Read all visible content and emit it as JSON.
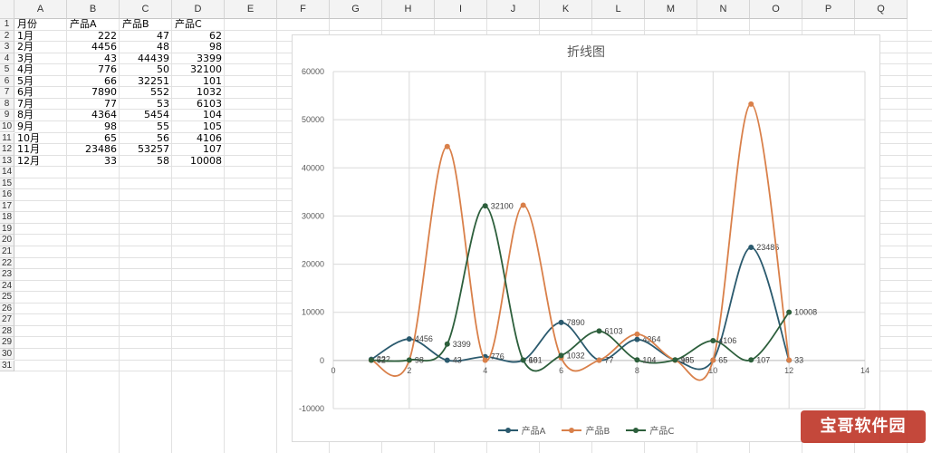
{
  "columns": [
    "A",
    "B",
    "C",
    "D",
    "E",
    "F",
    "G",
    "H",
    "I",
    "J",
    "K",
    "L",
    "M",
    "N",
    "O",
    "P",
    "Q"
  ],
  "row_numbers": [
    "1",
    "2",
    "3",
    "4",
    "5",
    "6",
    "7",
    "8",
    "9",
    "10",
    "11",
    "12",
    "13",
    "14",
    "15",
    "16",
    "17",
    "18",
    "19",
    "20",
    "21",
    "22",
    "23",
    "24",
    "25",
    "26",
    "27",
    "28",
    "29",
    "30",
    "31"
  ],
  "table": {
    "header": [
      "月份",
      "产品A",
      "产品B",
      "产品C"
    ],
    "rows": [
      [
        "1月",
        "222",
        "47",
        "62"
      ],
      [
        "2月",
        "4456",
        "48",
        "98"
      ],
      [
        "3月",
        "43",
        "44439",
        "3399"
      ],
      [
        "4月",
        "776",
        "50",
        "32100"
      ],
      [
        "5月",
        "66",
        "32251",
        "101"
      ],
      [
        "6月",
        "7890",
        "552",
        "1032"
      ],
      [
        "7月",
        "77",
        "53",
        "6103"
      ],
      [
        "8月",
        "4364",
        "5454",
        "104"
      ],
      [
        "9月",
        "98",
        "55",
        "105"
      ],
      [
        "10月",
        "65",
        "56",
        "4106"
      ],
      [
        "11月",
        "23486",
        "53257",
        "107"
      ],
      [
        "12月",
        "33",
        "58",
        "10008"
      ]
    ]
  },
  "chart_data": {
    "type": "scatter",
    "title": "折线图",
    "xlim": [
      0,
      14
    ],
    "ylim": [
      -10000,
      60000
    ],
    "x_ticks": [
      0,
      2,
      4,
      6,
      8,
      10,
      12,
      14
    ],
    "y_ticks": [
      -10000,
      0,
      10000,
      20000,
      30000,
      40000,
      50000,
      60000
    ],
    "grid": true,
    "smooth": true,
    "legend_position": "bottom",
    "series": [
      {
        "name": "产品A",
        "color": "#2b5a6e",
        "x": [
          1,
          2,
          3,
          4,
          5,
          6,
          7,
          8,
          9,
          10,
          11,
          12
        ],
        "values": [
          222,
          4456,
          43,
          776,
          66,
          7890,
          77,
          4364,
          98,
          65,
          23486,
          33
        ],
        "labels": [
          "222",
          "4456",
          "43",
          "776",
          "66",
          "7890",
          "77",
          "4364",
          "98",
          "65",
          "23486",
          "33"
        ]
      },
      {
        "name": "产品B",
        "color": "#d9804a",
        "x": [
          1,
          2,
          3,
          4,
          5,
          6,
          7,
          8,
          9,
          10,
          11,
          12
        ],
        "values": [
          47,
          48,
          44439,
          50,
          32251,
          552,
          53,
          5454,
          55,
          56,
          53257,
          58
        ],
        "labels": []
      },
      {
        "name": "产品C",
        "color": "#2d5f3c",
        "x": [
          1,
          2,
          3,
          4,
          5,
          6,
          7,
          8,
          9,
          10,
          11,
          12
        ],
        "values": [
          62,
          98,
          3399,
          32100,
          101,
          1032,
          6103,
          104,
          105,
          4106,
          107,
          10008
        ],
        "labels": [
          "62",
          "98",
          "3399",
          "32100",
          "101",
          "1032",
          "6103",
          "104",
          "105",
          "4106",
          "107",
          "10008"
        ]
      }
    ]
  },
  "watermark_text": "宝哥软件园"
}
